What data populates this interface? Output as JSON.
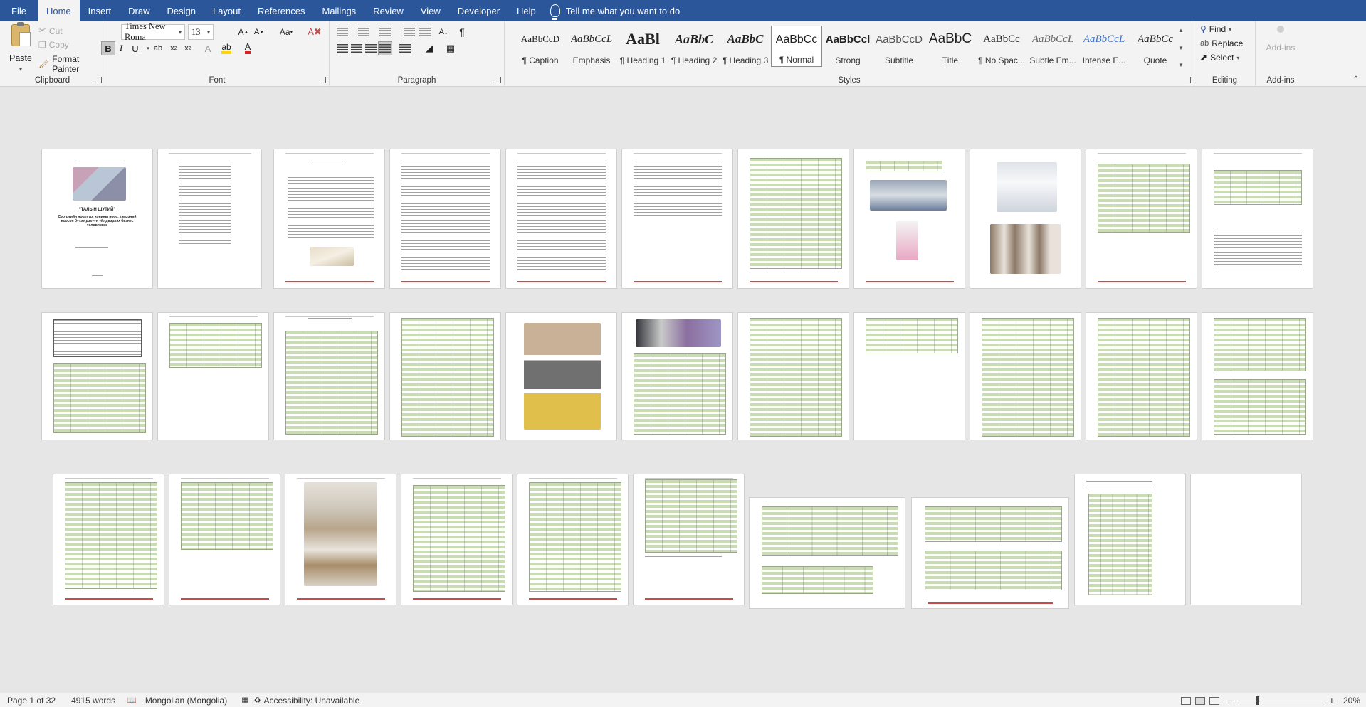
{
  "menu": {
    "tabs": [
      "File",
      "Home",
      "Insert",
      "Draw",
      "Design",
      "Layout",
      "References",
      "Mailings",
      "Review",
      "View",
      "Developer",
      "Help"
    ],
    "active_tab": "Home",
    "tell_me": "Tell me what you want to do"
  },
  "ribbon": {
    "clipboard": {
      "label": "Clipboard",
      "paste": "Paste",
      "cut": "Cut",
      "copy": "Copy",
      "format_painter": "Format Painter"
    },
    "font": {
      "label": "Font",
      "font_name": "Times New Roma",
      "font_size": "13"
    },
    "paragraph": {
      "label": "Paragraph"
    },
    "styles": {
      "label": "Styles",
      "items": [
        {
          "preview": "AaBbCcD",
          "name": "¶ Caption"
        },
        {
          "preview": "AaBbCcL",
          "name": "Emphasis"
        },
        {
          "preview": "AaBl",
          "name": "¶ Heading 1"
        },
        {
          "preview": "AaBbC",
          "name": "¶ Heading 2"
        },
        {
          "preview": "AaBbC",
          "name": "¶ Heading 3"
        },
        {
          "preview": "AaBbCc",
          "name": "¶ Normal"
        },
        {
          "preview": "AaBbCcl",
          "name": "Strong"
        },
        {
          "preview": "AaBbCcD",
          "name": "Subtitle"
        },
        {
          "preview": "AaBbC",
          "name": "Title"
        },
        {
          "preview": "AaBbCc",
          "name": "¶ No Spac..."
        },
        {
          "preview": "AaBbCcL",
          "name": "Subtle Em..."
        },
        {
          "preview": "AaBbCcL",
          "name": "Intense E..."
        },
        {
          "preview": "AaBbCc",
          "name": "Quote"
        }
      ],
      "selected": "¶ Normal"
    },
    "editing": {
      "label": "Editing",
      "find": "Find",
      "replace": "Replace",
      "select": "Select"
    },
    "addins": {
      "label": "Add-ins",
      "button": "Add-ins"
    }
  },
  "document": {
    "cover_title": "“ТАЛЫН ШУТИЙ”",
    "cover_subtitle": "Сэрлэгийн ноолуур, хонины ноос, тэмээний ноосон бүтээгдэхүүн үйлдвэрлэх бизнес төлөвлөгөө"
  },
  "status": {
    "page": "Page 1 of 32",
    "words": "4915 words",
    "language": "Mongolian (Mongolia)",
    "accessibility": "Accessibility: Unavailable",
    "zoom": "20%"
  },
  "colors": {
    "brand": "#2b579a",
    "table_fill": "#c9dcb4",
    "rule_red": "#c94a4a"
  }
}
